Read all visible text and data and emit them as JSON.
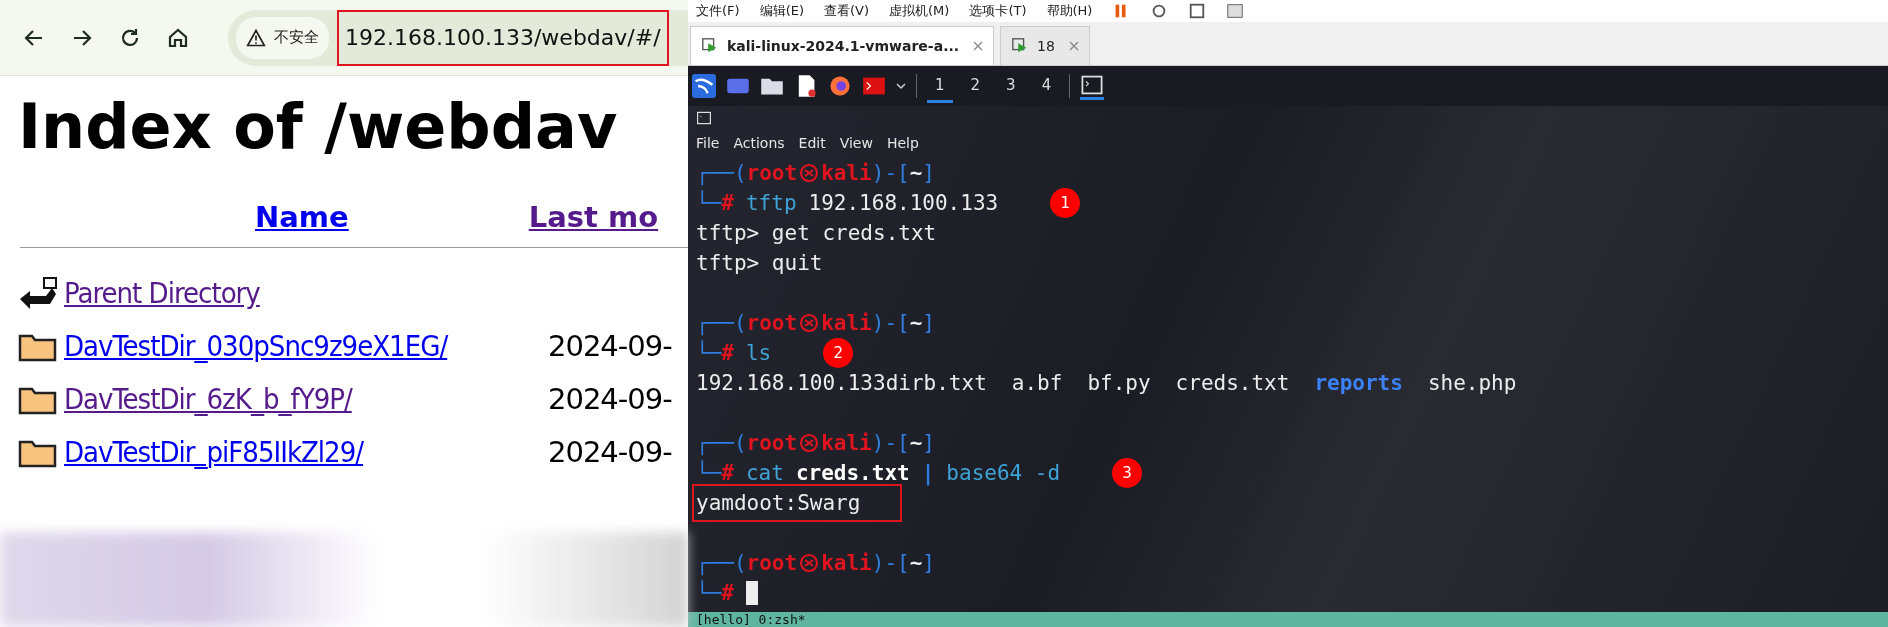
{
  "browser": {
    "security_label": "不安全",
    "address": "192.168.100.133/webdav/#/",
    "address_highlighted": true
  },
  "page": {
    "heading": "Index of /webdav",
    "columns": [
      "Name",
      "Last mo"
    ],
    "entries": [
      {
        "kind": "parent",
        "name": "Parent Directory",
        "visited": true
      },
      {
        "kind": "folder",
        "name": "DavTestDir_030pSnc9z9eX1EG/",
        "date": "2024-09-",
        "visited": false
      },
      {
        "kind": "folder",
        "name": "DavTestDir_6zK_b_fY9P/",
        "date": "2024-09-",
        "visited": true
      },
      {
        "kind": "folder",
        "name": "DavTestDir_piF85IIkZl29/",
        "date": "2024-09-",
        "visited": false
      }
    ]
  },
  "vmware": {
    "menu": [
      "文件(F)",
      "编辑(E)",
      "查看(V)",
      "虚拟机(M)",
      "选项卡(T)",
      "帮助(H)"
    ],
    "tabs": [
      {
        "label": "kali-linux-2024.1-vmware-a...",
        "selected": true
      },
      {
        "label": "18",
        "selected": false
      }
    ]
  },
  "kali_panel": {
    "workspaces": [
      {
        "label": "1",
        "selected": true
      },
      {
        "label": "2",
        "selected": false
      },
      {
        "label": "3",
        "selected": false
      },
      {
        "label": "4",
        "selected": false
      }
    ]
  },
  "terminal": {
    "menu": [
      "File",
      "Actions",
      "Edit",
      "View",
      "Help"
    ],
    "blocks": [
      {
        "prompt": {
          "open": "┌──(",
          "user": "root",
          "host": "kali",
          "mid": ")-[",
          "dir": "~",
          "close": "]",
          "corner": "└─",
          "hash": "#"
        },
        "command": [
          {
            "text": "tftp",
            "kind": "cmd"
          },
          {
            "text": "192.168.100.133",
            "kind": "arg"
          }
        ],
        "marker": "1",
        "cursor": false,
        "output": [
          {
            "boxed": false,
            "segments": [
              {
                "text": "tftp> get creds.txt",
                "kind": "plain"
              }
            ]
          },
          {
            "boxed": false,
            "segments": [
              {
                "text": "tftp> quit",
                "kind": "plain"
              }
            ]
          }
        ]
      },
      {
        "prompt": {
          "open": "┌──(",
          "user": "root",
          "host": "kali",
          "mid": ")-[",
          "dir": "~",
          "close": "]",
          "corner": "└─",
          "hash": "#"
        },
        "command": [
          {
            "text": "ls",
            "kind": "cmd"
          }
        ],
        "marker": "2",
        "cursor": false,
        "output": [
          {
            "boxed": false,
            "segments": [
              {
                "text": "192.168.100.133dirb.txt",
                "kind": "plain"
              },
              {
                "text": "a.bf",
                "kind": "plain"
              },
              {
                "text": "bf.py",
                "kind": "plain"
              },
              {
                "text": "creds.txt",
                "kind": "plain"
              },
              {
                "text": "reports",
                "kind": "dir"
              },
              {
                "text": "she.php",
                "kind": "plain"
              }
            ]
          }
        ]
      },
      {
        "prompt": {
          "open": "┌──(",
          "user": "root",
          "host": "kali",
          "mid": ")-[",
          "dir": "~",
          "close": "]",
          "corner": "└─",
          "hash": "#"
        },
        "command": [
          {
            "text": "cat",
            "kind": "cmd"
          },
          {
            "text": "creds.txt",
            "kind": "bold"
          },
          {
            "text": "|",
            "kind": "pipe"
          },
          {
            "text": "base64 -d",
            "kind": "cmd"
          }
        ],
        "marker": "3",
        "cursor": false,
        "output": [
          {
            "boxed": true,
            "segments": [
              {
                "text": "yamdoot:Swarg",
                "kind": "plain"
              }
            ]
          }
        ]
      },
      {
        "prompt": {
          "open": "┌──(",
          "user": "root",
          "host": "kali",
          "mid": ")-[",
          "dir": "~",
          "close": "]",
          "corner": "└─",
          "hash": "#"
        },
        "cursor": true
      }
    ],
    "status": "[hello] 0:zsh*"
  }
}
